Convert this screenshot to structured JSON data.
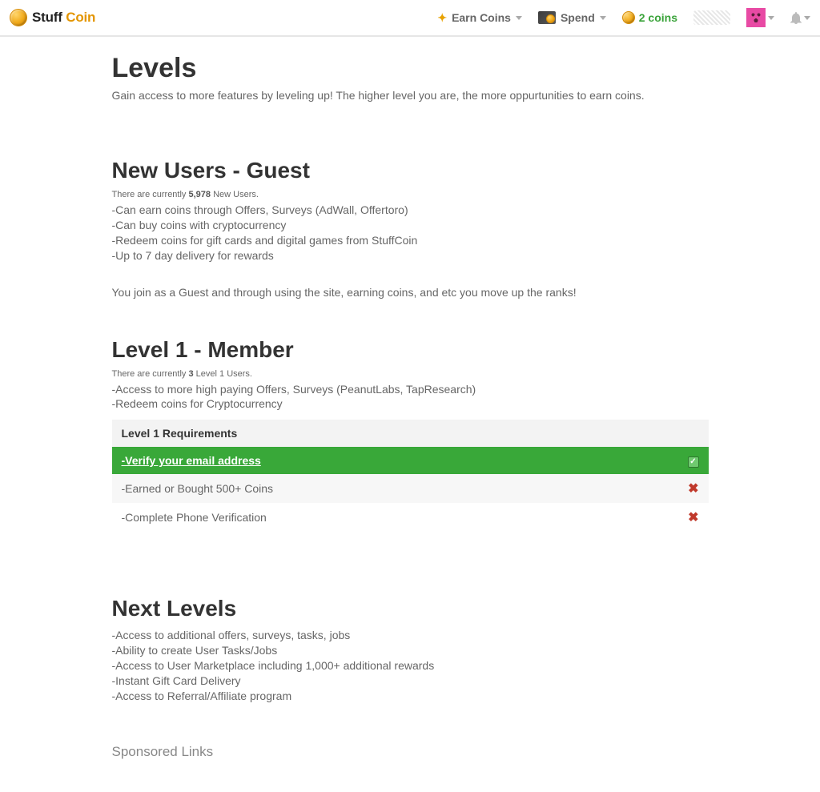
{
  "brand": {
    "stuff": "Stuff",
    "coin": "Coin"
  },
  "nav": {
    "earn": "Earn Coins",
    "spend": "Spend",
    "coins": "2 coins"
  },
  "page": {
    "title": "Levels",
    "subtitle": "Gain access to more features by leveling up! The higher level you are, the more oppurtunities to earn coins."
  },
  "guest": {
    "heading": "New Users - Guest",
    "count_prefix": "There are currently ",
    "count_value": "5,978",
    "count_suffix": " New Users.",
    "bullets": [
      "-Can earn coins through Offers, Surveys (AdWall, Offertoro)",
      "-Can buy coins with cryptocurrency",
      "-Redeem coins for gift cards and digital games from StuffCoin",
      "-Up to 7 day delivery for rewards"
    ],
    "note": "You join as a Guest and through using the site, earning coins, and etc you move up the ranks!"
  },
  "level1": {
    "heading": "Level 1 - Member",
    "count_prefix": "There are currently ",
    "count_value": "3",
    "count_suffix": " Level 1 Users.",
    "bullets": [
      "-Access to more high paying Offers, Surveys (PeanutLabs, TapResearch)",
      "-Redeem coins for Cryptocurrency"
    ],
    "req_header": "Level 1 Requirements",
    "reqs": [
      {
        "text": "-Verify your email address",
        "status": "done"
      },
      {
        "text": "-Earned or Bought 500+ Coins",
        "status": "not"
      },
      {
        "text": "-Complete Phone Verification",
        "status": "not"
      }
    ]
  },
  "next": {
    "heading": "Next Levels",
    "bullets": [
      "-Access to additional offers, surveys, tasks, jobs",
      "-Ability to create User Tasks/Jobs",
      "-Access to User Marketplace including 1,000+ additional rewards",
      "-Instant Gift Card Delivery",
      "-Access to Referral/Affiliate program"
    ]
  },
  "sponsored": "Sponsored Links"
}
